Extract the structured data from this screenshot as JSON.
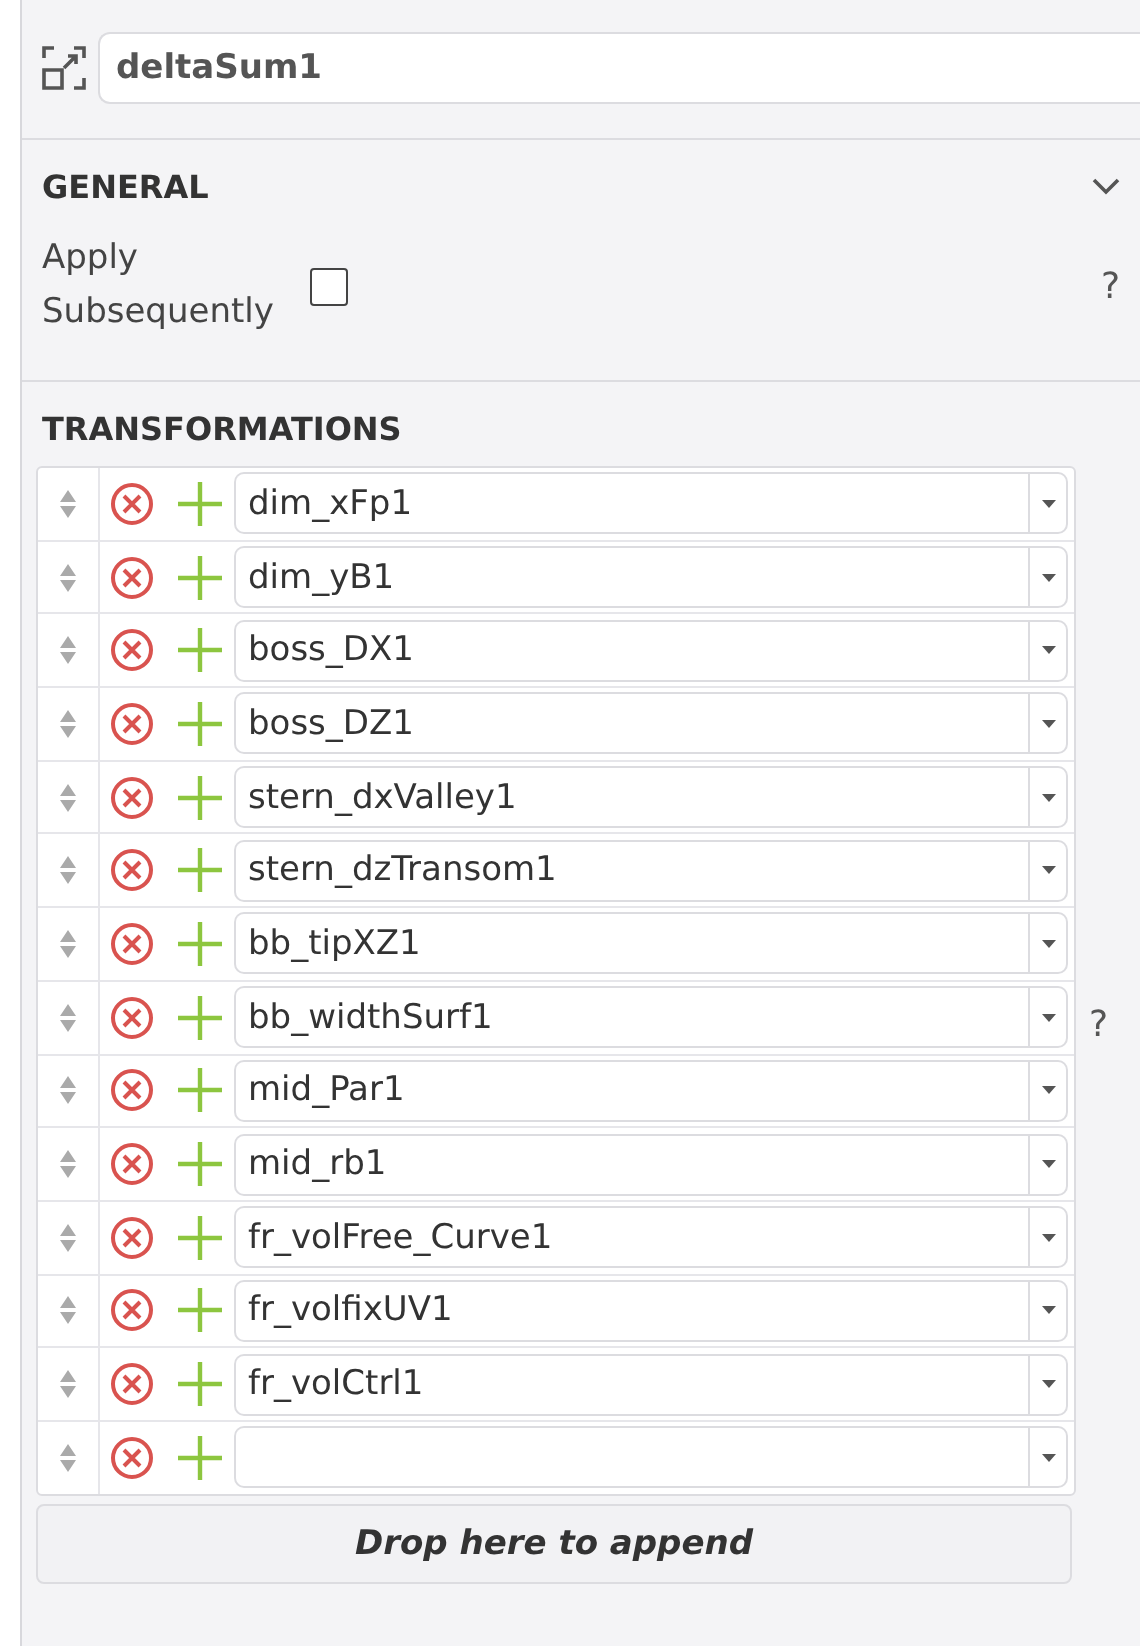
{
  "name_field": {
    "value": "deltaSum1"
  },
  "general": {
    "title": "GENERAL",
    "expanded": true,
    "apply_subsequently": {
      "label": "Apply Subsequently",
      "checked": false,
      "help": "?"
    }
  },
  "transformations": {
    "title": "TRANSFORMATIONS",
    "help": "?",
    "rows": [
      {
        "value": "dim_xFp1"
      },
      {
        "value": "dim_yB1"
      },
      {
        "value": "boss_DX1"
      },
      {
        "value": "boss_DZ1"
      },
      {
        "value": "stern_dxValley1"
      },
      {
        "value": "stern_dzTransom1"
      },
      {
        "value": "bb_tipXZ1"
      },
      {
        "value": "bb_widthSurf1"
      },
      {
        "value": "mid_Par1"
      },
      {
        "value": "mid_rb1"
      },
      {
        "value": "fr_volFree_Curve1"
      },
      {
        "value": "fr_volfixUV1"
      },
      {
        "value": "fr_volCtrl1"
      },
      {
        "value": ""
      }
    ],
    "drop_zone": "Drop here to append"
  }
}
